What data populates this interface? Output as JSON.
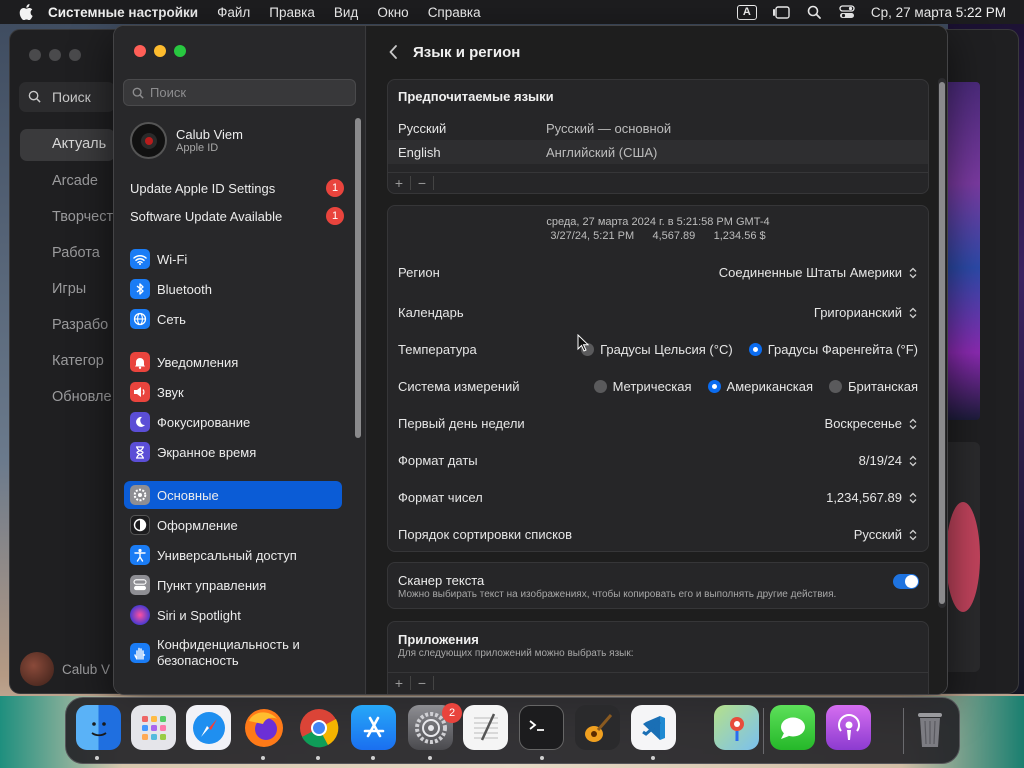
{
  "menubar": {
    "app_name": "Системные настройки",
    "items": [
      "Файл",
      "Правка",
      "Вид",
      "Окно",
      "Справка"
    ],
    "input_indicator": "A",
    "datetime": "Ср, 27 марта  5:22 PM"
  },
  "background_window": {
    "search_placeholder": "Поиск",
    "items": [
      "Актуаль",
      "Arcade",
      "Творчест",
      "Работа",
      "Игры",
      "Разрабо",
      "Категор",
      "Обновле"
    ],
    "user_name": "Calub V"
  },
  "sidebar": {
    "search_placeholder": "Поиск",
    "user": {
      "name": "Calub Viem",
      "subtitle": "Apple ID"
    },
    "notifications": [
      {
        "label": "Update Apple ID Settings",
        "badge": "1"
      },
      {
        "label": "Software Update Available",
        "badge": "1"
      }
    ],
    "items": [
      {
        "label": "Wi-Fi",
        "icon": "wifi-icon",
        "color": "#1a7cf5"
      },
      {
        "label": "Bluetooth",
        "icon": "bluetooth-icon",
        "color": "#1a7cf5"
      },
      {
        "label": "Сеть",
        "icon": "globe-icon",
        "color": "#1a7cf5"
      },
      {
        "label": "Уведомления",
        "icon": "bell-icon",
        "color": "#e9443d"
      },
      {
        "label": "Звук",
        "icon": "speaker-icon",
        "color": "#e9443d"
      },
      {
        "label": "Фокусирование",
        "icon": "moon-icon",
        "color": "#5b4ed6"
      },
      {
        "label": "Экранное время",
        "icon": "hourglass-icon",
        "color": "#5b4ed6"
      },
      {
        "label": "Основные",
        "icon": "gear-icon",
        "color": "#8e8e93",
        "selected": true
      },
      {
        "label": "Оформление",
        "icon": "appearance-icon",
        "color": "#1c1c1e"
      },
      {
        "label": "Универсальный доступ",
        "icon": "accessibility-icon",
        "color": "#1a7cf5"
      },
      {
        "label": "Пункт управления",
        "icon": "control-center-icon",
        "color": "#8e8e93"
      },
      {
        "label": "Siri и Spotlight",
        "icon": "siri-icon",
        "color": "#b03ad0"
      },
      {
        "label": "Конфиденциальность и безопасность",
        "icon": "hand-icon",
        "color": "#1a7cf5"
      }
    ]
  },
  "content": {
    "title": "Язык и регион",
    "preferred": {
      "title": "Предпочитаемые языки",
      "languages": [
        {
          "name": "Русский",
          "desc": "Русский — основной"
        },
        {
          "name": "English",
          "desc": "Английский (США)"
        }
      ],
      "add": "+",
      "remove": "−"
    },
    "region_card": {
      "preview_line1": "среда, 27 марта 2024 г. в 5:21:58 PM GMT-4",
      "preview_line2": "3/27/24, 5:21 PM      4,567.89      1,234.56 $",
      "rows": {
        "region": {
          "label": "Регион",
          "value": "Соединенные Штаты Америки"
        },
        "calendar": {
          "label": "Календарь",
          "value": "Григорианский"
        },
        "temperature": {
          "label": "Температура",
          "options": [
            "Градусы Цельсия (°C)",
            "Градусы Фаренгейта (°F)"
          ],
          "selected": "Градусы Фаренгейта (°F)"
        },
        "measurement": {
          "label": "Система измерений",
          "options": [
            "Метрическая",
            "Американская",
            "Британская"
          ],
          "selected": "Американская"
        },
        "first_day": {
          "label": "Первый день недели",
          "value": "Воскресенье"
        },
        "date_format": {
          "label": "Формат даты",
          "value": "8/19/24"
        },
        "number_format": {
          "label": "Формат чисел",
          "value": "1,234,567.89"
        },
        "sort_order": {
          "label": "Порядок сортировки списков",
          "value": "Русский"
        }
      }
    },
    "live_text": {
      "title": "Сканер текста",
      "description": "Можно выбирать текст на изображениях, чтобы копировать его и выполнять другие действия.",
      "enabled": true
    },
    "apps": {
      "title": "Приложения",
      "description": "Для следующих приложений можно выбрать язык:",
      "add": "+",
      "remove": "−"
    }
  },
  "dock": {
    "apps": [
      "finder",
      "launchpad",
      "safari",
      "firefox",
      "chrome",
      "app-store",
      "system-settings",
      "textedit",
      "terminal",
      "garageband",
      "vscode",
      "maps",
      "messages",
      "podcasts",
      "trash"
    ],
    "settings_badge": "2"
  },
  "colors": {
    "accent": "#0b5cd6",
    "badge": "#e9443d",
    "toggle": "#1e73e0"
  }
}
